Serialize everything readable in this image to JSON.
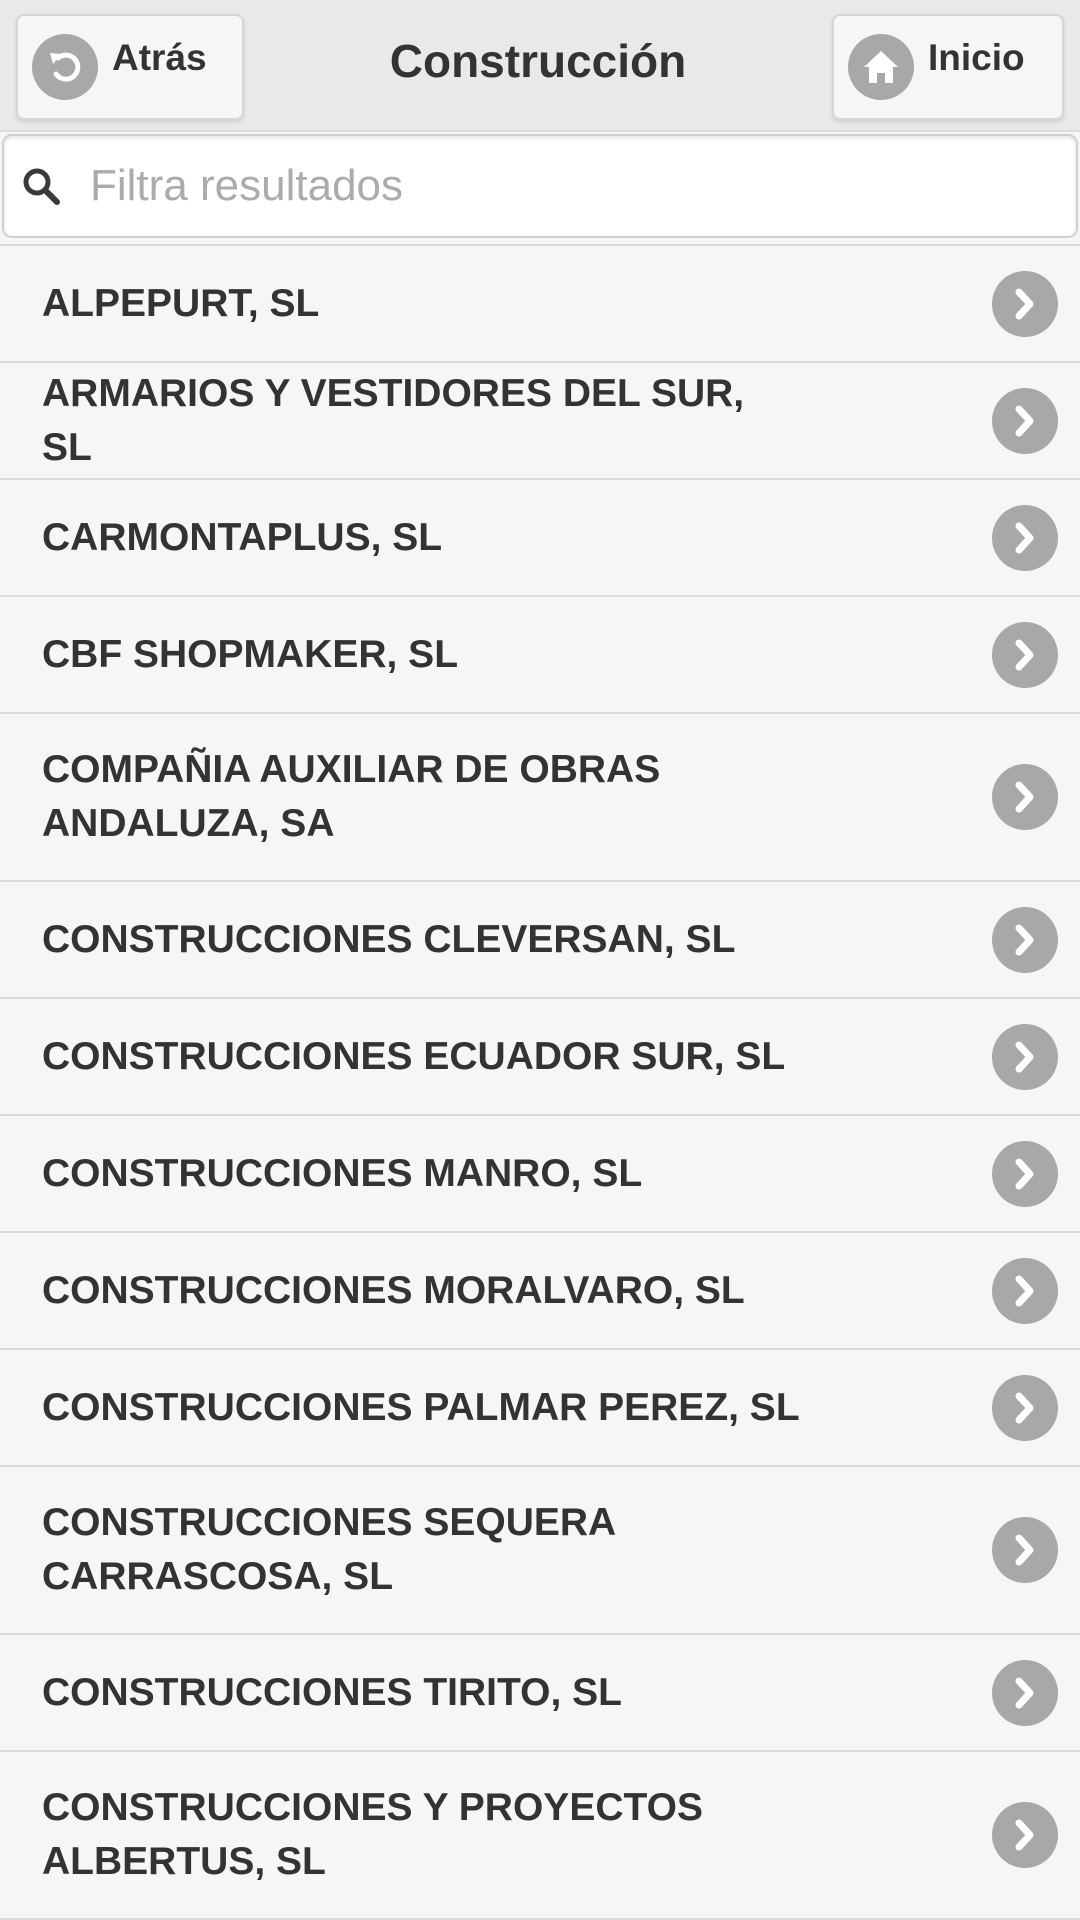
{
  "header": {
    "title": "Construcción",
    "back_label": "Atrás",
    "home_label": "Inicio"
  },
  "search": {
    "placeholder": "Filtra resultados",
    "value": ""
  },
  "list": {
    "items": [
      {
        "label": "ALPEPURT, SL"
      },
      {
        "label": "ARMARIOS Y VESTIDORES DEL SUR, SL"
      },
      {
        "label": "CARMONTAPLUS, SL"
      },
      {
        "label": "CBF SHOPMAKER, SL"
      },
      {
        "label": "COMPAÑIA AUXILIAR DE OBRAS ANDALUZA, SA"
      },
      {
        "label": "CONSTRUCCIONES CLEVERSAN, SL"
      },
      {
        "label": "CONSTRUCCIONES ECUADOR SUR, SL"
      },
      {
        "label": "CONSTRUCCIONES MANRO, SL"
      },
      {
        "label": "CONSTRUCCIONES MORALVARO, SL"
      },
      {
        "label": "CONSTRUCCIONES PALMAR PEREZ, SL"
      },
      {
        "label": "CONSTRUCCIONES SEQUERA CARRASCOSA, SL"
      },
      {
        "label": "CONSTRUCCIONES TIRITO, SL"
      },
      {
        "label": "CONSTRUCCIONES Y PROYECTOS ALBERTUS, SL"
      }
    ]
  },
  "icons": {
    "back": "back-arrow-icon",
    "home": "home-icon",
    "search": "search-icon",
    "chevron": "chevron-right-icon"
  },
  "colors": {
    "header_bg": "#e9e9e9",
    "list_bg": "#f6f6f6",
    "text": "#333333",
    "icon_circle": "#a8a8a8",
    "placeholder": "#ababab"
  }
}
